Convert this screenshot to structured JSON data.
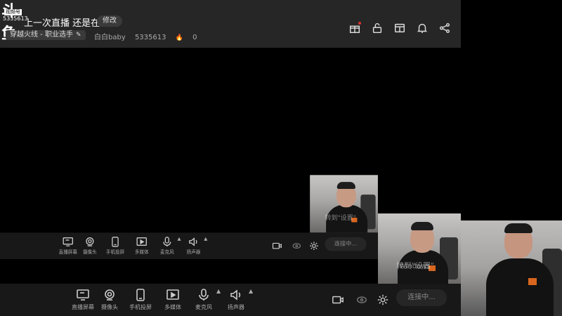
{
  "header": {
    "logo_text": "斗鱼",
    "logo_tag": "视频号",
    "room_id_mini": "5335613",
    "title": "上一次直播 还是在上次",
    "edit_label": "修改",
    "category": "穿越火线 - 职业选手",
    "streamer": "白白baby",
    "room_id": "5335613",
    "heat": "0",
    "icons": [
      "gift-icon",
      "unlock-icon",
      "layout-icon",
      "bell-icon",
      "share-icon"
    ]
  },
  "toolbar": {
    "tools": [
      {
        "name": "screen-share",
        "label": "直播屏幕",
        "icon": "monitor-icon"
      },
      {
        "name": "camera",
        "label": "摄像头",
        "icon": "camera-icon"
      },
      {
        "name": "phone-share",
        "label": "手机投屏",
        "icon": "phone-icon"
      },
      {
        "name": "media",
        "label": "多媒体",
        "icon": "play-icon"
      },
      {
        "name": "microphone",
        "label": "麦克风",
        "icon": "mic-icon"
      },
      {
        "name": "speaker",
        "label": "扬声器",
        "icon": "speaker-icon"
      }
    ],
    "connect_label": "连接中..."
  },
  "preview": {
    "watermark_cn": "转到\"设置\"",
    "watermark_en": "Windows"
  },
  "colors": {
    "header_bg": "#262626",
    "toolbar_bg": "#181818",
    "accent_red": "#e03030"
  }
}
